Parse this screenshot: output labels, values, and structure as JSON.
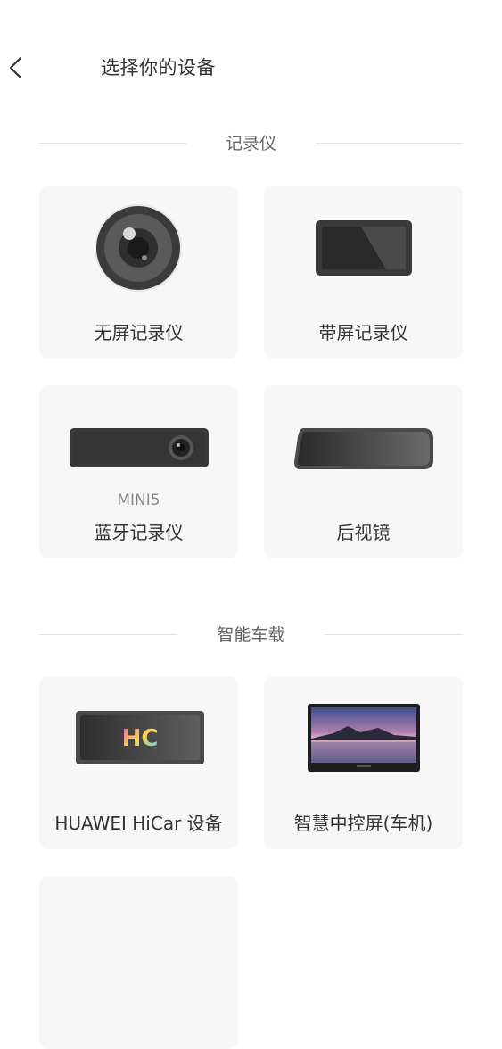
{
  "header": {
    "title": "选择你的设备"
  },
  "sections": [
    {
      "title": "记录仪",
      "cards": [
        {
          "label": "无屏记录仪",
          "icon": "camera-lens-icon"
        },
        {
          "label": "带屏记录仪",
          "icon": "screen-recorder-icon"
        },
        {
          "label": "蓝牙记录仪",
          "sublabel": "MINI5",
          "icon": "bluetooth-recorder-icon"
        },
        {
          "label": "后视镜",
          "icon": "rearview-mirror-icon"
        }
      ]
    },
    {
      "title": "智能车载",
      "cards": [
        {
          "label": "HUAWEI HiCar 设备",
          "icon": "hicar-screen-icon",
          "logo_text": "HC"
        },
        {
          "label": "智慧中控屏(车机)",
          "icon": "center-console-screen-icon"
        }
      ]
    }
  ]
}
